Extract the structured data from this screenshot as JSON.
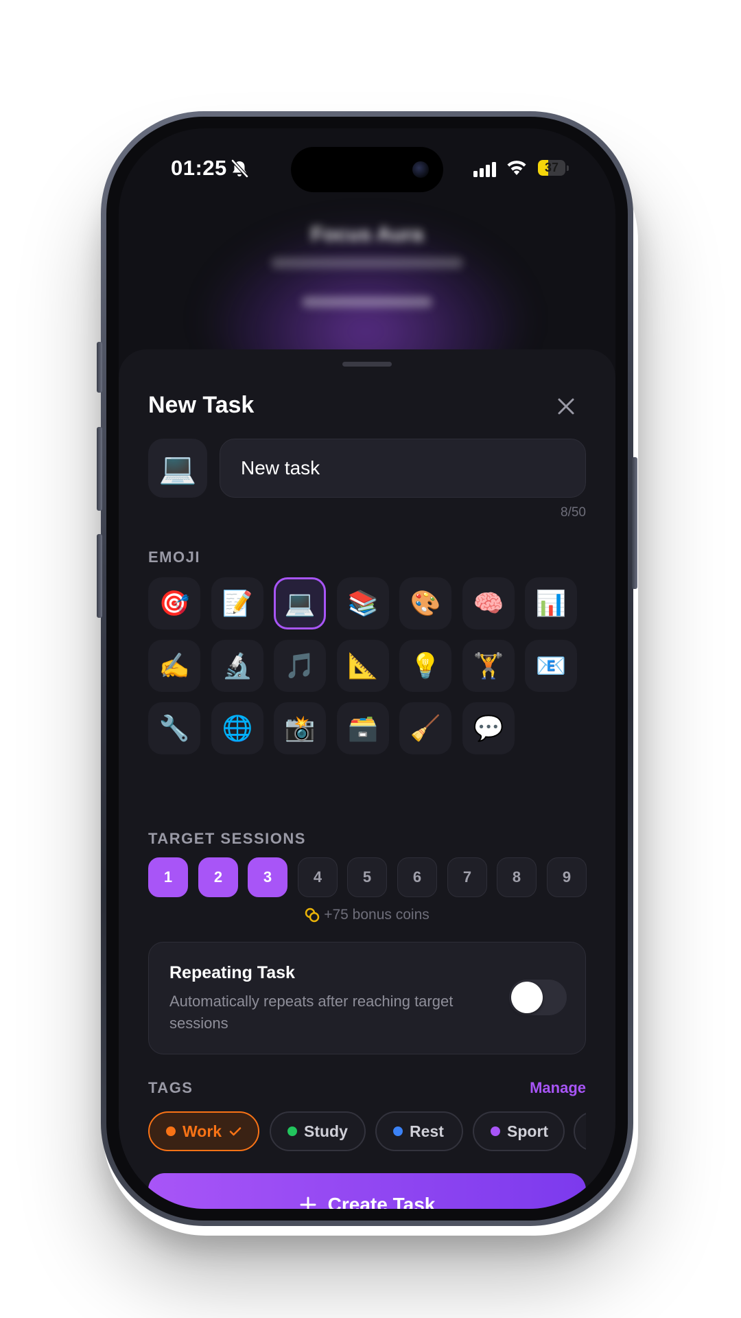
{
  "status_bar": {
    "time": "01:25",
    "battery": "37",
    "battery_level": 0.37
  },
  "background": {
    "title": "Focus Aura"
  },
  "sheet": {
    "title": "New Task",
    "task_name": "New task",
    "char_count": "8/50",
    "selected_emoji": "💻"
  },
  "emoji_section": {
    "label": "EMOJI",
    "items": [
      {
        "emoji": "🎯",
        "name": "target"
      },
      {
        "emoji": "📝",
        "name": "memo"
      },
      {
        "emoji": "💻",
        "name": "laptop",
        "selected": true
      },
      {
        "emoji": "📚",
        "name": "books"
      },
      {
        "emoji": "🎨",
        "name": "palette"
      },
      {
        "emoji": "🧠",
        "name": "brain"
      },
      {
        "emoji": "📊",
        "name": "bar-chart"
      },
      {
        "emoji": "✍️",
        "name": "writing-hand"
      },
      {
        "emoji": "🔬",
        "name": "microscope"
      },
      {
        "emoji": "🎵",
        "name": "music-note"
      },
      {
        "emoji": "📐",
        "name": "triangle-ruler"
      },
      {
        "emoji": "💡",
        "name": "light-bulb"
      },
      {
        "emoji": "🏋️",
        "name": "weight-lifter"
      },
      {
        "emoji": "📧",
        "name": "email"
      },
      {
        "emoji": "🔧",
        "name": "wrench"
      },
      {
        "emoji": "🌐",
        "name": "globe"
      },
      {
        "emoji": "📸",
        "name": "camera-flash"
      },
      {
        "emoji": "🗃️",
        "name": "card-file-box"
      },
      {
        "emoji": "🧹",
        "name": "broom"
      },
      {
        "emoji": "💬",
        "name": "speech-bubble"
      }
    ]
  },
  "sessions": {
    "label": "TARGET SESSIONS",
    "options": [
      "1",
      "2",
      "3",
      "4",
      "5",
      "6",
      "7",
      "8",
      "9"
    ],
    "selected": 3,
    "bonus": "+75 bonus coins"
  },
  "repeating": {
    "title": "Repeating Task",
    "description": "Automatically repeats after reaching target sessions",
    "enabled": false
  },
  "tags": {
    "label": "TAGS",
    "manage": "Manage",
    "items": [
      {
        "label": "Work",
        "color": "#f97316",
        "selected": true
      },
      {
        "label": "Study",
        "color": "#22c55e",
        "selected": false
      },
      {
        "label": "Rest",
        "color": "#3b82f6",
        "selected": false
      },
      {
        "label": "Sport",
        "color": "#a855f7",
        "selected": false
      }
    ]
  },
  "actions": {
    "create": "Create Task"
  },
  "colors": {
    "accent": "#a855f7",
    "accent_dark": "#7c3aed",
    "sheet_bg": "#17171d",
    "work_orange": "#f97316"
  }
}
